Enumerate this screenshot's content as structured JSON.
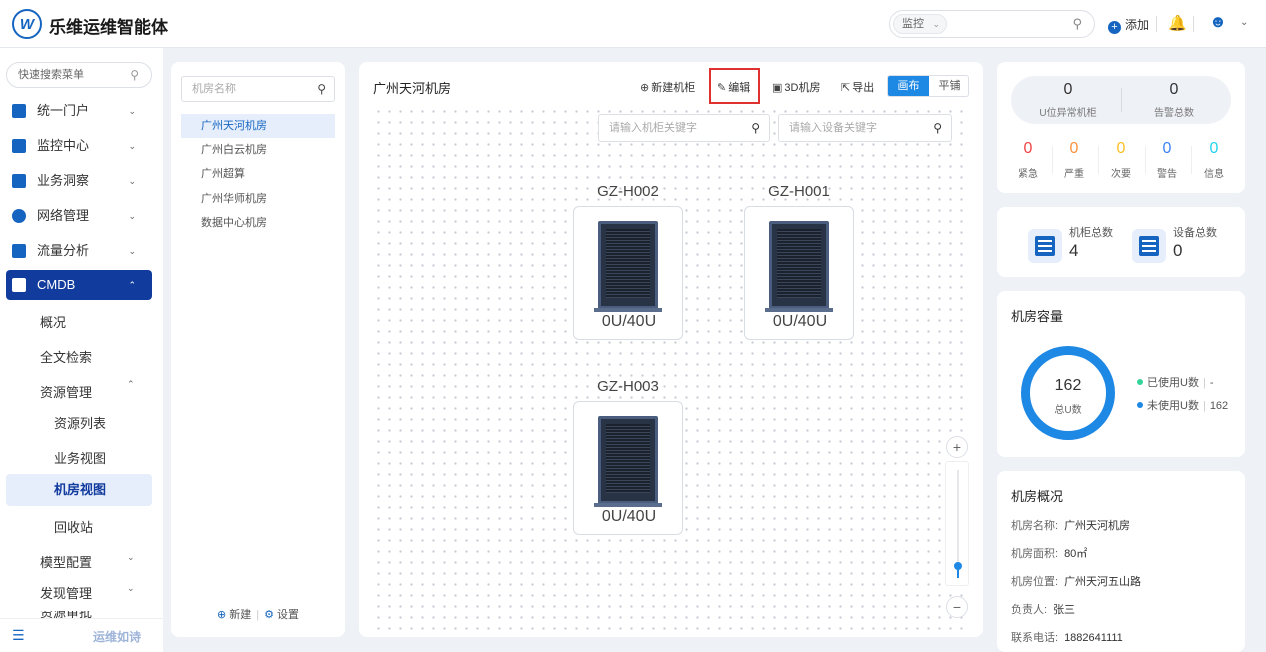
{
  "header": {
    "brand": "乐维运维智能体",
    "logo_letter": "W",
    "search_scope": "监控",
    "search_scope_chevron": "⌄",
    "add_label": "添加"
  },
  "sidebar": {
    "search_placeholder": "快速搜索菜单",
    "menu": [
      {
        "label": "统一门户",
        "icon": "home-icon"
      },
      {
        "label": "监控中心",
        "icon": "monitor-icon"
      },
      {
        "label": "业务洞察",
        "icon": "insight-icon"
      },
      {
        "label": "网络管理",
        "icon": "globe-icon"
      },
      {
        "label": "流量分析",
        "icon": "chart-icon"
      },
      {
        "label": "CMDB",
        "icon": "cube-icon"
      }
    ],
    "cmdb_children": [
      "概况",
      "全文检索",
      "资源管理"
    ],
    "resource_children": [
      "资源列表",
      "业务视图",
      "机房视图",
      "回收站"
    ],
    "more": [
      "模型配置",
      "发现管理",
      "资源审批"
    ],
    "footer_motto": "运维如诗"
  },
  "room_panel": {
    "search_placeholder": "机房名称",
    "rooms": [
      "广州天河机房",
      "广州白云机房",
      "广州超算",
      "广州华师机房",
      "数据中心机房"
    ],
    "selected_index": 0,
    "new_label": "新建",
    "settings_label": "设置"
  },
  "canvas": {
    "title": "广州天河机房",
    "toolbar": {
      "new_rack": "新建机柜",
      "edit": "编辑",
      "room_3d": "3D机房",
      "export": "导出",
      "mode_canvas": "画布",
      "mode_tile": "平铺",
      "active_mode": "画布"
    },
    "rack_search_placeholder": "请输入机柜关键字",
    "device_search_placeholder": "请输入设备关键字",
    "racks": [
      {
        "name": "GZ-H002",
        "usage": "0U/40U"
      },
      {
        "name": "GZ-H001",
        "usage": "0U/40U"
      },
      {
        "name": "GZ-H003",
        "usage": "0U/40U"
      }
    ],
    "zoom_level": 0.1
  },
  "alerts": {
    "u_abnormal_racks": "0",
    "u_abnormal_label": "U位异常机柜",
    "alarm_total": "0",
    "alarm_total_label": "告警总数",
    "levels": [
      {
        "label": "紧急",
        "value": "0",
        "color": "#ef4444"
      },
      {
        "label": "严重",
        "value": "0",
        "color": "#fb923c"
      },
      {
        "label": "次要",
        "value": "0",
        "color": "#fbbf24"
      },
      {
        "label": "警告",
        "value": "0",
        "color": "#3b82f6"
      },
      {
        "label": "信息",
        "value": "0",
        "color": "#22d3ee"
      }
    ]
  },
  "totals": {
    "rack_label": "机柜总数",
    "rack_value": "4",
    "device_label": "设备总数",
    "device_value": "0"
  },
  "capacity": {
    "title": "机房容量",
    "total": "162",
    "total_label": "总U数",
    "used_label": "已使用U数",
    "used_value": "-",
    "used_color": "#34d399",
    "free_label": "未使用U数",
    "free_value": "162",
    "free_color": "#1e88e5"
  },
  "overview": {
    "title": "机房概况",
    "rows": [
      {
        "label": "机房名称:",
        "value": "广州天河机房"
      },
      {
        "label": "机房面积:",
        "value": "80㎡"
      },
      {
        "label": "机房位置:",
        "value": "广州天河五山路"
      },
      {
        "label": "负责人:",
        "value": "张三"
      },
      {
        "label": "联系电话:",
        "value": "1882641111"
      }
    ]
  },
  "colors": {
    "primary": "#1565c0",
    "nav_active": "#123b9e",
    "accent": "#1e88e5",
    "highlight_border": "#e03131"
  }
}
